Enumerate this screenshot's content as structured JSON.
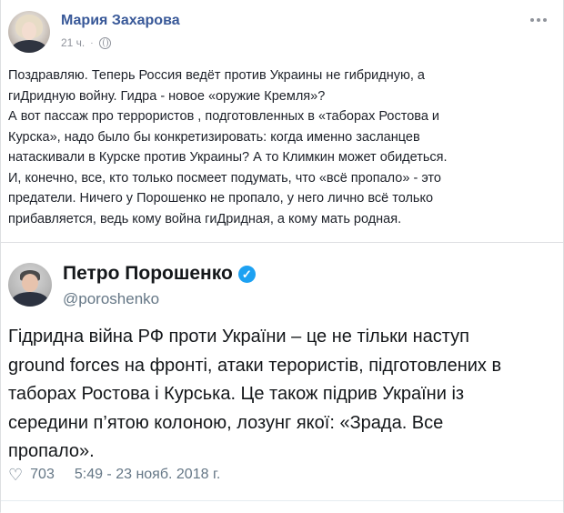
{
  "post": {
    "author": "Мария Захарова",
    "time": "21 ч.",
    "separator": "·",
    "lines": [
      "Поздравляю. Теперь Россия ведёт против Украины не гибридную, а",
      "гиДридную войну. Гидра - новое «оружие Кремля»?",
      "А вот пассаж про террористов , подготовленных в «таборах Ростова и",
      "Курска», надо было бы конкретизировать: когда именно засланцев",
      "натаскивали в Курске против Украины? А то Климкин может обидеться.",
      "И, конечно, все, кто только посмеет подумать, что «всё пропало» - это",
      "предатели. Ничего у Порошенко не пропало, у него лично всё только",
      "прибавляется, ведь кому война гиДридная, а кому мать родная."
    ]
  },
  "tweet": {
    "name": "Петро Порошенко",
    "verified_mark": "✓",
    "handle": "@poroshenko",
    "lines": [
      "Гідридна війна РФ проти України – це не тільки наступ",
      "ground forces на фронті, атаки терористів, підготовлених в",
      "таборах Ростова і Курська. Це також підрив України із",
      "середини п’ятою колоною, лозунг якої: «Зрада. Все",
      "пропало»."
    ],
    "heart_icon": "♡",
    "likes": "703",
    "timestamp": "5:49 - 23 нояб. 2018 г."
  }
}
